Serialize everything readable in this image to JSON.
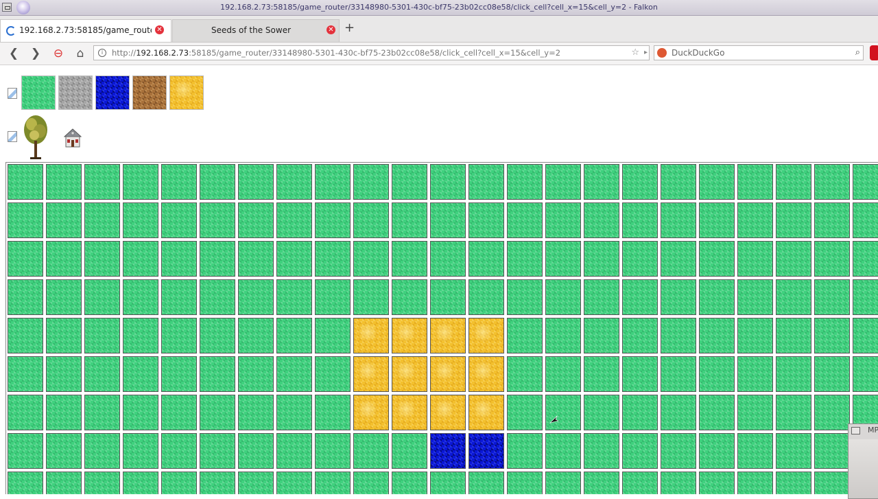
{
  "window": {
    "title": "192.168.2.73:58185/game_router/33148980-5301-430c-bf75-23b02cc08e58/click_cell?cell_x=15&cell_y=2 - Falkon"
  },
  "tabs": [
    {
      "label": "192.168.2.73:58185/game_route…",
      "state": "loading",
      "active": true
    },
    {
      "label": "Seeds of the Sower",
      "active": false
    }
  ],
  "toolbar": {
    "url_prefix": "http://",
    "url_host": "192.168.2.73",
    "url_rest": ":58185/game_router/33148980-5301-430c-bf75-23b02cc08e58/click_cell?cell_x=15&cell_y=2",
    "search_placeholder": "DuckDuckGo"
  },
  "popup_window": {
    "title": "MP"
  },
  "colors": {
    "grass": "#3fd17e",
    "stone": "#a6a6a6",
    "water": "#0a17d6",
    "dirt": "#a8713a",
    "sand": "#f3c02d"
  },
  "palette": {
    "terrain_tiles": [
      "grass",
      "stone",
      "water",
      "dirt",
      "sand"
    ],
    "objects": [
      "tree-icon",
      "house-icon"
    ]
  },
  "grid": {
    "rows": [
      [
        "grass",
        "grass",
        "grass",
        "grass",
        "grass",
        "grass",
        "grass",
        "grass",
        "grass",
        "grass",
        "grass",
        "grass",
        "grass",
        "grass",
        "grass",
        "grass",
        "grass",
        "grass",
        "grass",
        "grass",
        "grass",
        "grass",
        "grass"
      ],
      [
        "grass",
        "grass",
        "grass",
        "grass",
        "grass",
        "grass",
        "grass",
        "grass",
        "grass",
        "grass",
        "grass",
        "grass",
        "grass",
        "grass",
        "grass",
        "grass",
        "grass",
        "grass",
        "grass",
        "grass",
        "grass",
        "grass",
        "grass"
      ],
      [
        "grass",
        "grass",
        "grass",
        "grass",
        "grass",
        "grass",
        "grass",
        "grass",
        "grass",
        "grass",
        "grass",
        "grass",
        "grass",
        "grass",
        "grass",
        "grass",
        "grass",
        "grass",
        "grass",
        "grass",
        "grass",
        "grass",
        "grass"
      ],
      [
        "grass",
        "grass",
        "grass",
        "grass",
        "grass",
        "grass",
        "grass",
        "grass",
        "grass",
        "grass",
        "grass",
        "grass",
        "grass",
        "grass",
        "grass",
        "grass",
        "grass",
        "grass",
        "grass",
        "grass",
        "grass",
        "grass",
        "grass"
      ],
      [
        "grass",
        "grass",
        "grass",
        "grass",
        "grass",
        "grass",
        "grass",
        "grass",
        "grass",
        "sand",
        "sand",
        "sand",
        "sand",
        "grass",
        "grass",
        "grass",
        "grass",
        "grass",
        "grass",
        "grass",
        "grass",
        "grass",
        "grass"
      ],
      [
        "grass",
        "grass",
        "grass",
        "grass",
        "grass",
        "grass",
        "grass",
        "grass",
        "grass",
        "sand",
        "sand",
        "sand",
        "sand",
        "grass",
        "grass",
        "grass",
        "grass",
        "grass",
        "grass",
        "grass",
        "grass",
        "grass",
        "grass"
      ],
      [
        "grass",
        "grass",
        "grass",
        "grass",
        "grass",
        "grass",
        "grass",
        "grass",
        "grass",
        "sand",
        "sand",
        "sand",
        "sand",
        "grass",
        "grass",
        "grass",
        "grass",
        "grass",
        "grass",
        "grass",
        "grass",
        "grass",
        "grass"
      ],
      [
        "grass",
        "grass",
        "grass",
        "grass",
        "grass",
        "grass",
        "grass",
        "grass",
        "grass",
        "grass",
        "grass",
        "water",
        "water",
        "grass",
        "grass",
        "grass",
        "grass",
        "grass",
        "grass",
        "grass",
        "grass",
        "grass",
        "grass"
      ],
      [
        "grass",
        "grass",
        "grass",
        "grass",
        "grass",
        "grass",
        "grass",
        "grass",
        "grass",
        "grass",
        "grass",
        "grass",
        "grass",
        "grass",
        "grass",
        "grass",
        "grass",
        "grass",
        "grass",
        "grass",
        "grass",
        "grass",
        "grass"
      ]
    ]
  }
}
